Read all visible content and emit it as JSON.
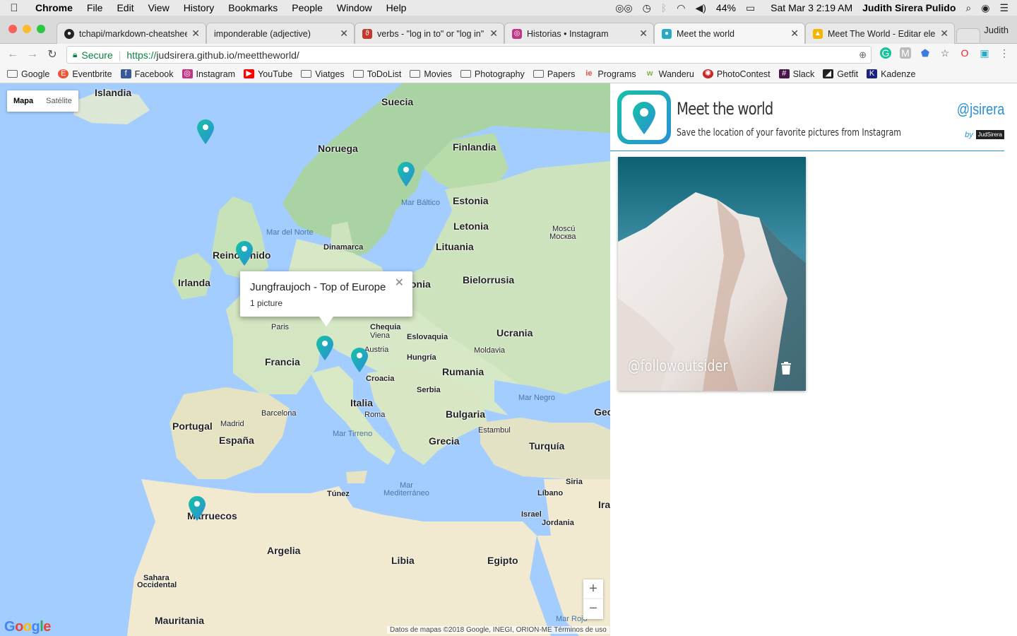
{
  "menubar": {
    "app": "Chrome",
    "items": [
      "File",
      "Edit",
      "View",
      "History",
      "Bookmarks",
      "People",
      "Window",
      "Help"
    ],
    "battery": "44%",
    "datetime": "Sat Mar 3  2:19 AM",
    "user": "Judith Sirera Pulido"
  },
  "tabs": [
    {
      "title": "tchapi/markdown-cheatsheet",
      "icon": "github-icon",
      "color": "#222222"
    },
    {
      "title": "imponderable (adjective)",
      "icon": "none",
      "color": "#e9e9e9"
    },
    {
      "title": "verbs - \"log in to\" or \"log in\"",
      "icon": "stackexchange-icon",
      "color": "#c0392b"
    },
    {
      "title": "Historias • Instagram",
      "icon": "instagram-icon",
      "color": "#c13584"
    },
    {
      "title": "Meet the world",
      "icon": "map-pin-icon",
      "color": "#27a9c7"
    },
    {
      "title": "Meet The World - Editar elemento",
      "icon": "drive-icon",
      "color": "#f4b400"
    }
  ],
  "profile": "Judith",
  "address": {
    "secure_label": "Secure",
    "url_proto": "https://",
    "url_rest": "judsirera.github.io/meettheworld/"
  },
  "bookmarks": [
    {
      "label": "Google",
      "icon": "folder-icon",
      "color": "#666666"
    },
    {
      "label": "Eventbrite",
      "icon": "eventbrite-icon",
      "color": "#f05537"
    },
    {
      "label": "Facebook",
      "icon": "facebook-icon",
      "color": "#3b5998"
    },
    {
      "label": "Instagram",
      "icon": "instagram-icon",
      "color": "#c13584"
    },
    {
      "label": "YouTube",
      "icon": "youtube-icon",
      "color": "#ff0000"
    },
    {
      "label": "Viatges",
      "icon": "folder-icon",
      "color": "#666666"
    },
    {
      "label": "ToDoList",
      "icon": "folder-icon",
      "color": "#666666"
    },
    {
      "label": "Movies",
      "icon": "folder-icon",
      "color": "#666666"
    },
    {
      "label": "Photography",
      "icon": "folder-icon",
      "color": "#666666"
    },
    {
      "label": "Papers",
      "icon": "folder-icon",
      "color": "#666666"
    },
    {
      "label": "Programs",
      "icon": "programs-icon",
      "color": "#e74c3c"
    },
    {
      "label": "Wanderu",
      "icon": "wanderu-icon",
      "color": "#7cb342"
    },
    {
      "label": "PhotoContest",
      "icon": "photocontest-icon",
      "color": "#c62828"
    },
    {
      "label": "Slack",
      "icon": "slack-icon",
      "color": "#4a154b"
    },
    {
      "label": "Getfit",
      "icon": "getfit-icon",
      "color": "#222222"
    },
    {
      "label": "Kadenze",
      "icon": "kadenze-icon",
      "color": "#1a237e"
    }
  ],
  "map": {
    "type_map": "Mapa",
    "type_satellite": "Satélite",
    "labels": {
      "islandia": "Islandia",
      "suecia": "Suecia",
      "noruega": "Noruega",
      "finlandia": "Finlandia",
      "estonia": "Estonia",
      "letonia": "Letonia",
      "lituania": "Lituania",
      "moscu": "Moscú",
      "moskva": "Москва",
      "bielorrusia": "Bielorrusia",
      "ucrania": "Ucrania",
      "moldavia": "Moldavia",
      "irlanda": "Irlanda",
      "reino_unido": "Reino Unido",
      "dinamarca": "Dinamarca",
      "polonia": "onia",
      "paris": "Paris",
      "francia": "Francia",
      "chequia": "Chequia",
      "viena": "Viena",
      "austria": "Austria",
      "eslovaquia": "Eslovaquia",
      "hungria": "Hungría",
      "rumania": "Rumania",
      "croacia": "Croacia",
      "serbia": "Serbia",
      "bulgaria": "Bulgaria",
      "italia": "Italia",
      "roma": "Roma",
      "grecia": "Grecia",
      "turquia": "Turquía",
      "estambul": "Estambul",
      "portugal": "Portugal",
      "madrid": "Madrid",
      "espana": "España",
      "barcelona": "Barcelona",
      "tunez": "Túnez",
      "marruecos": "Marruecos",
      "argelia": "Argelia",
      "libia": "Libia",
      "egipto": "Egipto",
      "siria": "Siria",
      "libano": "Líbano",
      "israel": "Israel",
      "jordania": "Jordania",
      "sahara": "Sahara",
      "occidental": "Occidental",
      "mauritania": "Mauritania",
      "georgia": "Geo",
      "iraq": "Ira",
      "mar_baltico": "Mar Báltico",
      "mar_norte": "Mar del Norte",
      "mar_negro": "Mar Negro",
      "mar_tirreno": "Mar Tirreno",
      "mar_med1": "Mar",
      "mar_med2": "Mediterráneo",
      "mar_rojo": "Mar Rojo"
    },
    "popup": {
      "title": "Jungfraujoch - Top of Europe",
      "subtitle": "1 picture"
    },
    "zoom_in": "+",
    "zoom_out": "−",
    "logo": "Google",
    "attribution": "Datos de mapas ©2018 Google, INEGI, ORION-ME    Términos de uso",
    "pin_color_a": "#16c2a4",
    "pin_color_b": "#2a8fd6"
  },
  "sidebar": {
    "title": "Meet the world",
    "subtitle": "Save the location of your favorite pictures from Instagram",
    "handle": "@jsirera",
    "by_label": "by",
    "by_logo": "JudSirera",
    "accent": "#2a8fd6",
    "card": {
      "username": "@followoutsider"
    }
  }
}
